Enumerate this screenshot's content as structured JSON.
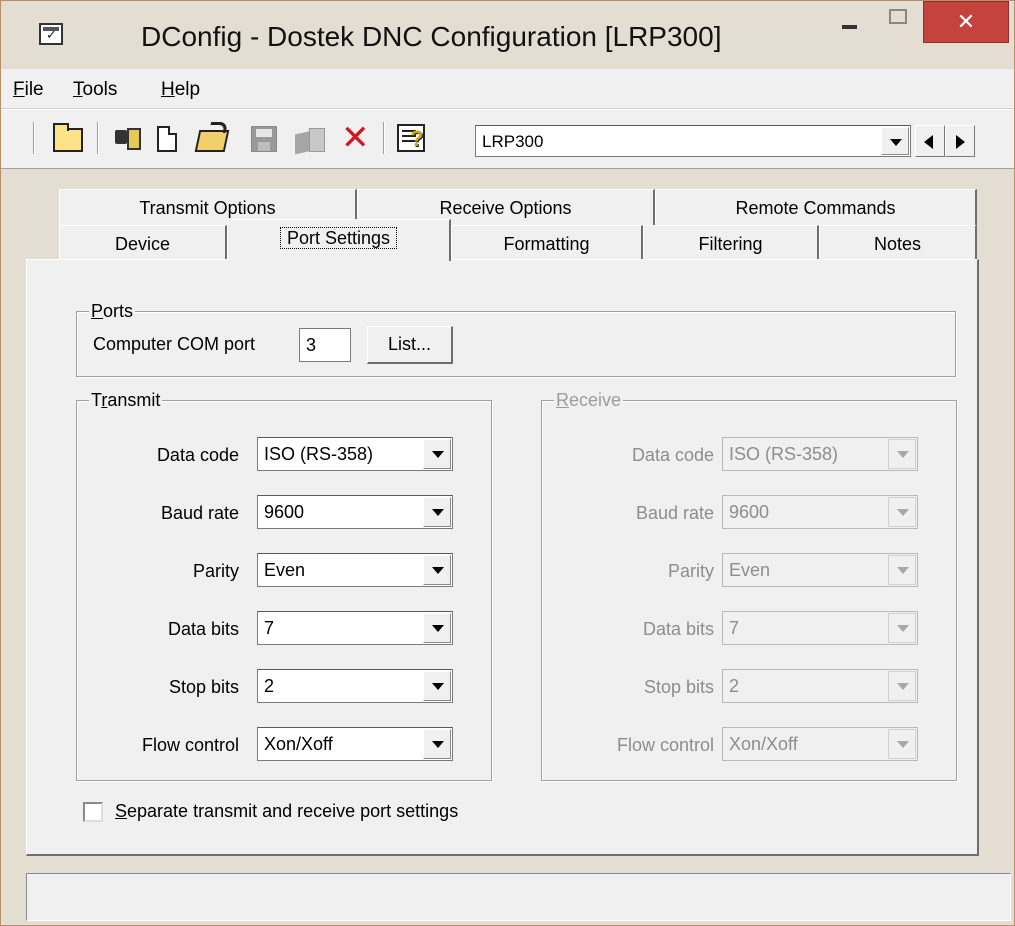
{
  "window": {
    "title": "DConfig - Dostek DNC Configuration [LRP300]"
  },
  "menu": {
    "file": {
      "accel": "F",
      "rest": "ile"
    },
    "tools": {
      "accel": "T",
      "rest": "ools"
    },
    "help": {
      "accel": "H",
      "rest": "elp"
    }
  },
  "toolbar": {
    "device_selector_value": "LRP300",
    "icons": [
      "folder-open-icon",
      "serial-cable-icon",
      "new-document-icon",
      "open-folder-icon",
      "save-icon",
      "save-as-icon",
      "delete-icon",
      "properties-icon"
    ]
  },
  "tabs": {
    "row1": [
      "Transmit Options",
      "Receive Options",
      "Remote Commands"
    ],
    "row2": [
      "Device",
      "Port Settings",
      "Formatting",
      "Filtering",
      "Notes"
    ],
    "active": "Port Settings"
  },
  "ports": {
    "title_accel": "P",
    "title_rest": "orts",
    "com_label": "Computer COM port",
    "com_value": "3",
    "list_button": "List..."
  },
  "transmit": {
    "title_pre": "T",
    "title_accel": "r",
    "title_rest": "ansmit",
    "fields": [
      {
        "label": "Data code",
        "value": "ISO (RS-358)"
      },
      {
        "label": "Baud rate",
        "value": "9600"
      },
      {
        "label": "Parity",
        "value": "Even"
      },
      {
        "label": "Data bits",
        "value": "7"
      },
      {
        "label": "Stop bits",
        "value": "2"
      },
      {
        "label": "Flow control",
        "value": "Xon/Xoff"
      }
    ]
  },
  "receive": {
    "title_accel": "R",
    "title_rest": "eceive",
    "enabled": false,
    "fields": [
      {
        "label": "Data code",
        "value": "ISO (RS-358)"
      },
      {
        "label": "Baud rate",
        "value": "9600"
      },
      {
        "label": "Parity",
        "value": "Even"
      },
      {
        "label": "Data bits",
        "value": "7"
      },
      {
        "label": "Stop bits",
        "value": "2"
      },
      {
        "label": "Flow control",
        "value": "Xon/Xoff"
      }
    ]
  },
  "separate_settings": {
    "accel": "S",
    "rest": "eparate transmit and receive port settings",
    "checked": false
  },
  "status": {
    "text": ""
  },
  "colors": {
    "close_button": "#c4433c",
    "disabled_text": "#8d8d8d"
  }
}
